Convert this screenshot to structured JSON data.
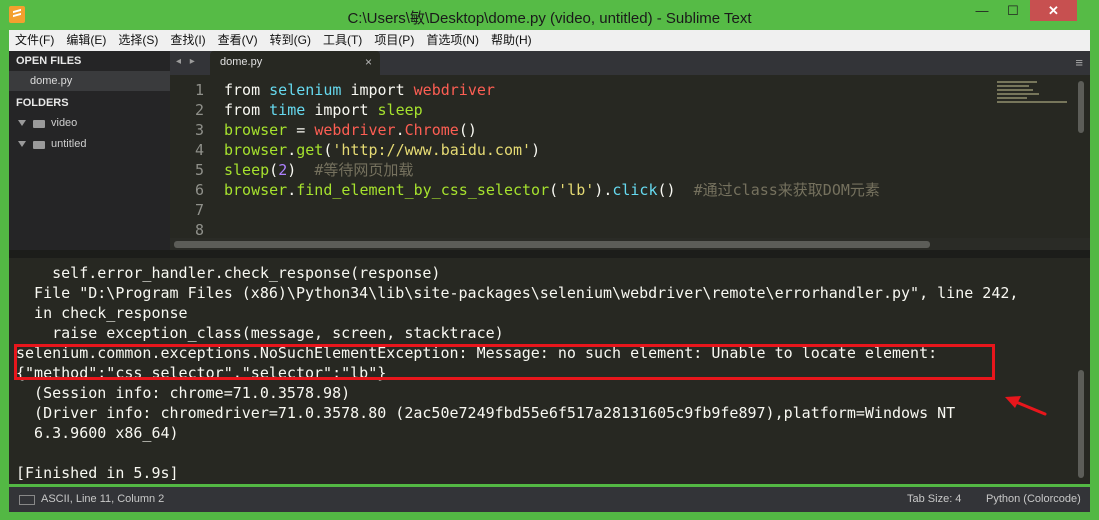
{
  "window": {
    "title": "C:\\Users\\敏\\Desktop\\dome.py (video, untitled) - Sublime Text",
    "minimize": "—",
    "maximize": "☐",
    "close": "✕"
  },
  "menu": [
    "文件(F)",
    "编辑(E)",
    "选择(S)",
    "查找(I)",
    "查看(V)",
    "转到(G)",
    "工具(T)",
    "项目(P)",
    "首选项(N)",
    "帮助(H)"
  ],
  "sidebar": {
    "open_files_header": "OPEN FILES",
    "open_files": [
      "dome.py"
    ],
    "folders_header": "FOLDERS",
    "folders": [
      "video",
      "untitled"
    ]
  },
  "tabs": {
    "nav": "◂ ▸",
    "active_tab": "dome.py",
    "close": "×",
    "menu": "≡"
  },
  "editor": {
    "line_numbers": [
      "1",
      "2",
      "3",
      "4",
      "5",
      "6",
      "7",
      "8"
    ],
    "code": {
      "l1": [
        "from",
        " ",
        "selenium",
        " ",
        "import",
        " ",
        "webdriver"
      ],
      "l2": [
        "from",
        " ",
        "time",
        " ",
        "import",
        " ",
        "sleep"
      ],
      "l3": [
        "browser",
        " = ",
        "webdriver",
        ".",
        "Chrome",
        "()"
      ],
      "l4": [
        "browser",
        ".",
        "get",
        "(",
        "'http://www.baidu.com'",
        ")"
      ],
      "l5": [
        "sleep",
        "(",
        "2",
        ")",
        "  ",
        "#等待网页加载"
      ],
      "l6": [
        "browser",
        ".",
        "find_element_by_css_selector",
        "(",
        "'lb'",
        ")",
        ".",
        "click",
        "()",
        "  ",
        "#通过class来获取DOM元素"
      ]
    }
  },
  "console": {
    "lines": [
      "    self.error_handler.check_response(response)",
      "  File \"D:\\Program Files (x86)\\Python34\\lib\\site-packages\\selenium\\webdriver\\remote\\errorhandler.py\", line 242,",
      "  in check_response",
      "    raise exception_class(message, screen, stacktrace)",
      "selenium.common.exceptions.NoSuchElementException: Message: no such element: Unable to locate element:",
      "{\"method\":\"css selector\",\"selector\":\"lb\"}",
      "  (Session info: chrome=71.0.3578.98)",
      "  (Driver info: chromedriver=71.0.3578.80 (2ac50e7249fbd55e6f517a28131605c9fb9fe897),platform=Windows NT",
      "  6.3.9600 x86_64)",
      "",
      "[Finished in 5.9s]"
    ]
  },
  "status": {
    "position": "ASCII, Line 11, Column 2",
    "tab_size": "Tab Size: 4",
    "syntax": "Python (Colorcode)"
  },
  "colors": {
    "title_bar": "#56bb46",
    "editor_bg": "#272822",
    "highlight_box": "#e8161c",
    "arrow": "#e8161c"
  }
}
